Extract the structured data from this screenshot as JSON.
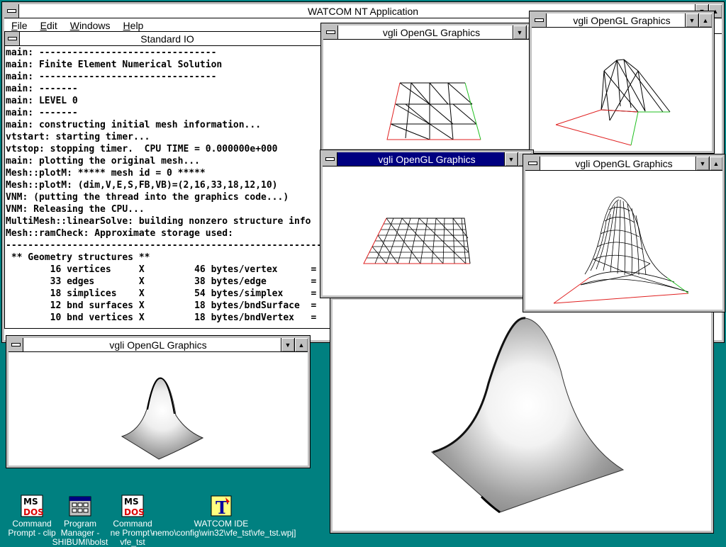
{
  "app": {
    "title": "WATCOM NT Application",
    "menu": [
      "File",
      "Edit",
      "Windows",
      "Help"
    ]
  },
  "std_io": {
    "title": "Standard IO",
    "lines": [
      "main: --------------------------------",
      "main: Finite Element Numerical Solution",
      "main: --------------------------------",
      "main: -------",
      "main: LEVEL 0",
      "main: -------",
      "main: constructing initial mesh information...",
      "vtstart: starting timer...",
      "vtstop: stopping timer.  CPU TIME = 0.000000e+000",
      "main: plotting the original mesh...",
      "Mesh::plotM: ***** mesh id = 0 *****",
      "Mesh::plotM: (dim,V,E,S,FB,VB)=(2,16,33,18,12,10)",
      "VNM: (putting the thread into the graphics code...)",
      "VNM: Releasing the CPU...",
      "MultiMesh::linearSolve: building nonzero structure info",
      "Mesh::ramCheck: Approximate storage used:",
      "----------------------------------------------------------------",
      " ** Geometry structures **",
      "        16 vertices     X         46 bytes/vertex      =",
      "        33 edges        X         38 bytes/edge        =",
      "        18 simplices    X         54 bytes/simplex     =",
      "        12 bnd surfaces X         18 bytes/bndSurface  =",
      "        10 bnd vertices X         18 bytes/bndVertex   =",
      "                          ------------------------------------"
    ]
  },
  "gl_window_title": "vgli OpenGL Graphics",
  "desktop_icons": [
    {
      "line1": "Command",
      "line2": "Prompt - clip"
    },
    {
      "line1": "Program",
      "line2": "Manager -",
      "line3": "SHIBUMI\\bolst"
    },
    {
      "line1": "Command",
      "line2": "ne Prompt - ",
      "line3": "vfe_tst"
    },
    {
      "line1": "WATCOM IDE",
      "line2": "\\nemo\\config\\win32\\vfe_tst\\vfe_tst.wpj]"
    }
  ],
  "colors": {
    "desktop": "#008080",
    "active_title": "#000080",
    "frame": "#c0c0c0"
  }
}
